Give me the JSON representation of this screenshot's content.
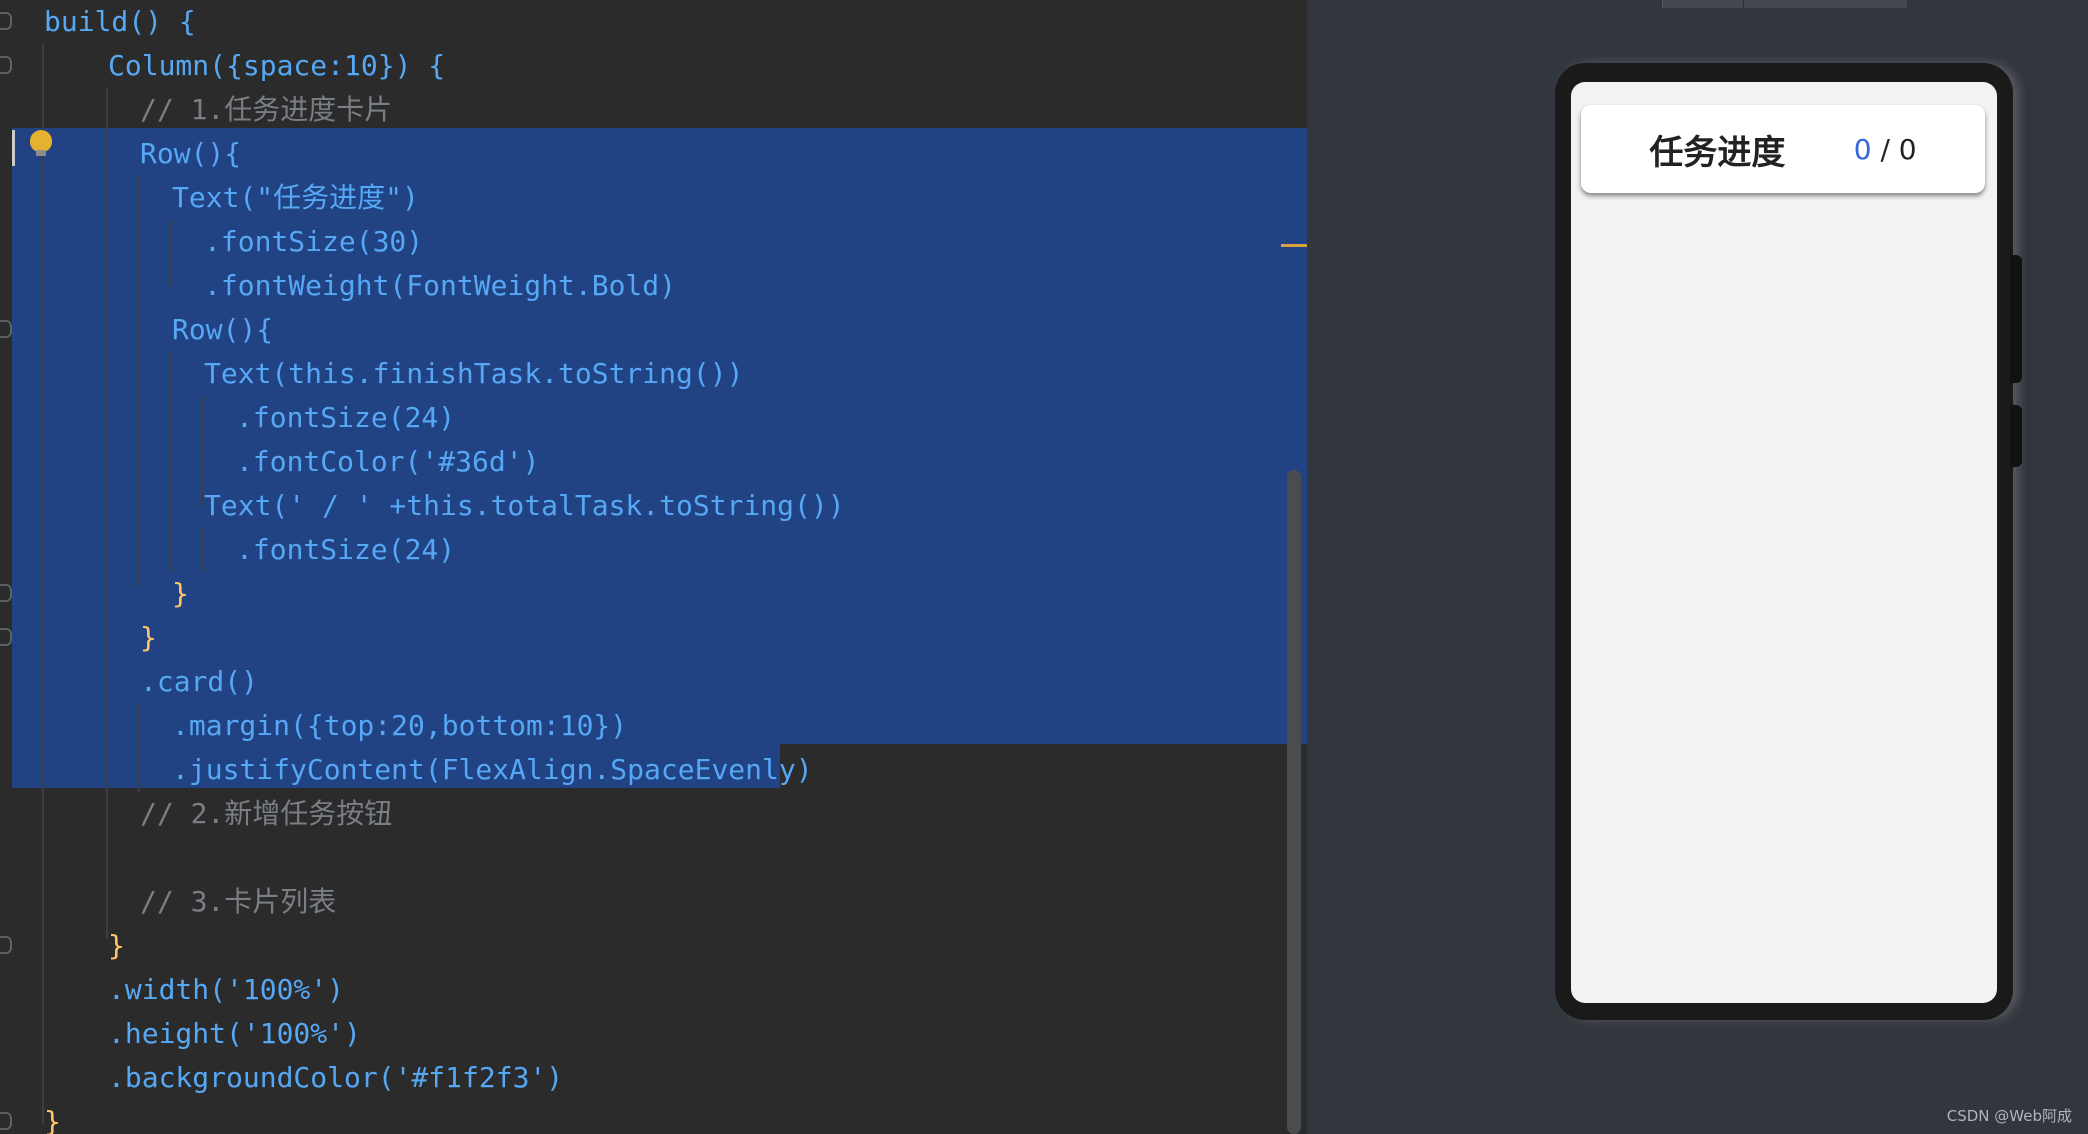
{
  "editor": {
    "lines": [
      "build() {",
      "Column({space:10}) {",
      "// 1.任务进度卡片",
      "Row(){",
      "Text(\"任务进度\")",
      ".fontSize(30)",
      ".fontWeight(FontWeight.Bold)",
      "Row(){",
      "Text(this.finishTask.toString())",
      ".fontSize(24)",
      ".fontColor('#36d')",
      "Text(' / ' +this.totalTask.toString())",
      ".fontSize(24)",
      "}",
      "}",
      ".card()",
      ".margin({top:20,bottom:10})",
      ".justifyContent(FlexAlign.SpaceEvenly)",
      "// 2.新增任务按钮",
      "",
      "// 3.卡片列表",
      "}",
      ".width('100%')",
      ".height('100%')",
      ".backgroundColor('#f1f2f3')",
      "}"
    ]
  },
  "preview": {
    "card_title": "任务进度",
    "finish_task": "0",
    "total_task": " / 0"
  },
  "watermark": "CSDN @Web阿成",
  "colors": {
    "editor_bg": "#2b2b2b",
    "selection": "#214283",
    "preview_bg": "#f1f2f3",
    "progress_accent": "#3366dd"
  }
}
